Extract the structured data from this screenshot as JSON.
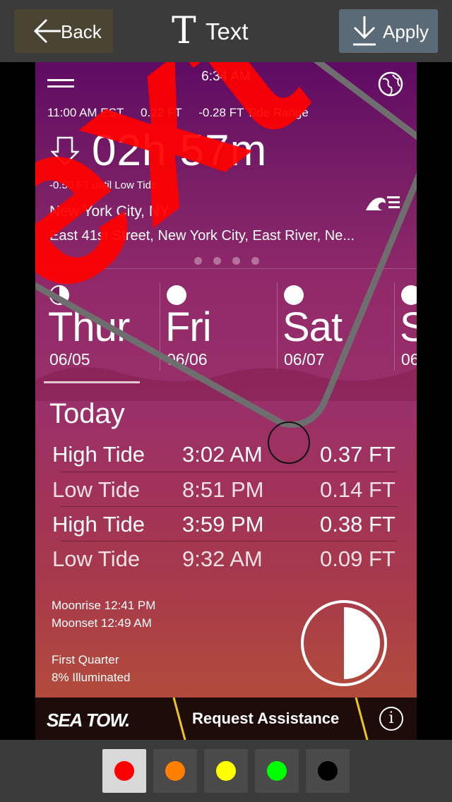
{
  "toolbar": {
    "back_label": "Back",
    "title_glyph": "T",
    "title": "Text",
    "apply_label": "Apply"
  },
  "app": {
    "time": "6:34 AM",
    "current": {
      "time": "11:00 AM EST",
      "height": "0.22 FT",
      "range": "-0.28 FT Tide Range"
    },
    "countdown": "02h 57m",
    "until": "-0.50 FT until Low Tide",
    "city": "New York City, NY",
    "address": "East 41st Street, New York City, East River, Ne...",
    "pages": 4,
    "days": [
      {
        "name": "Thur",
        "date": "06/05"
      },
      {
        "name": "Fri",
        "date": "06/06"
      },
      {
        "name": "Sat",
        "date": "06/07"
      },
      {
        "name": "S",
        "date": "06"
      }
    ],
    "today_label": "Today",
    "tides": [
      {
        "type": "High Tide",
        "time": "3:02 AM",
        "height": "0.37 FT"
      },
      {
        "type": "Low Tide",
        "time": "8:51 PM",
        "height": "0.14 FT"
      },
      {
        "type": "High Tide",
        "time": "3:59 PM",
        "height": "0.38 FT"
      },
      {
        "type": "Low Tide",
        "time": "9:32 AM",
        "height": "0.09 FT"
      }
    ],
    "moonrise": "Moonrise  12:41 PM",
    "moonset": "Moonset  12:49 AM",
    "phase": "First Quarter",
    "illuminated": "8%  Illuminated",
    "sponsor": "SEA TOW.",
    "assist_label": "Request Assistance",
    "info_glyph": "i"
  },
  "annotation": {
    "text": "ext",
    "color": "#ff0000"
  },
  "palette": [
    {
      "name": "red",
      "color": "#ff0000",
      "selected": true
    },
    {
      "name": "orange",
      "color": "#ff7f00",
      "selected": false
    },
    {
      "name": "yellow",
      "color": "#ffff00",
      "selected": false
    },
    {
      "name": "green",
      "color": "#00ff00",
      "selected": false
    },
    {
      "name": "black",
      "color": "#000000",
      "selected": false
    }
  ]
}
